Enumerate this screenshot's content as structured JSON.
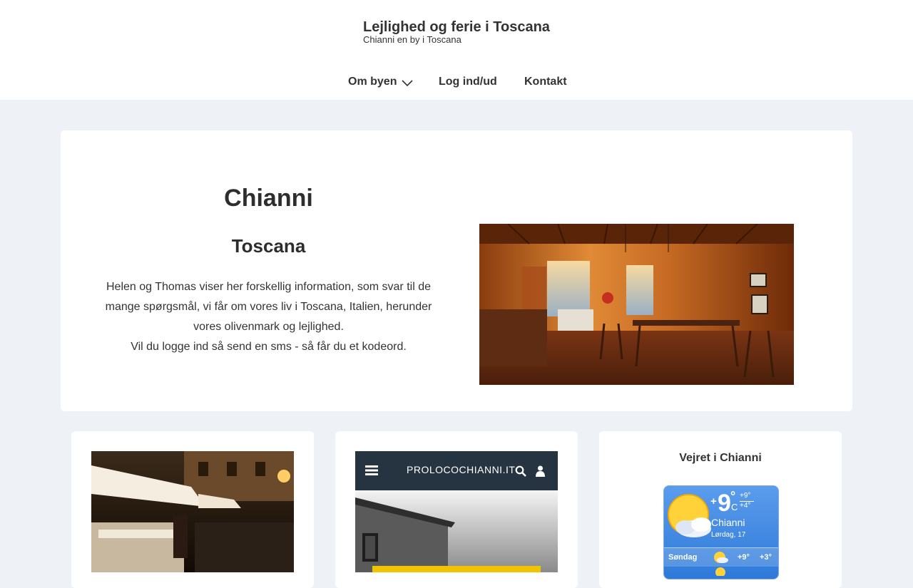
{
  "header": {
    "title": "Lejlighed og ferie i Toscana",
    "tagline": "Chianni en by i Toscana"
  },
  "nav": {
    "items": [
      {
        "label": "Om byen",
        "icon": "chevron-down-icon"
      },
      {
        "label": "Log ind/ud"
      },
      {
        "label": "Kontakt"
      }
    ]
  },
  "hero": {
    "title": "Chianni",
    "subtitle": "Toscana",
    "paragraph": "Helen og Thomas viser her forskellig information, som svar til de mange spørgsmål, vi får om vores liv i Toscana, Italien, herunder vores olivenmark og lejlighed.",
    "paragraph2": "Vil du logge ind så send en sms - så får du et kodeord."
  },
  "cards": {
    "proloco": {
      "site_label": "PROLOCOCHIANNI.IT",
      "icons": [
        "menu-icon",
        "search-icon",
        "user-icon"
      ]
    },
    "weather": {
      "title": "Vejret i Chianni",
      "temp_sign": "+",
      "temp": "9",
      "unit": "C",
      "high": "+9°",
      "low": "+4°",
      "city": "Chianni",
      "date": "Lørdag, 17",
      "forecast": [
        {
          "day": "Søndag",
          "high": "+9°",
          "low": "+3°"
        }
      ]
    }
  },
  "colors": {
    "page_bg": "#eef2f7",
    "card_bg": "#ffffff",
    "text": "#2d2d2d",
    "proloco_bar": "#263340",
    "weather_blue": "#2e79d9"
  }
}
